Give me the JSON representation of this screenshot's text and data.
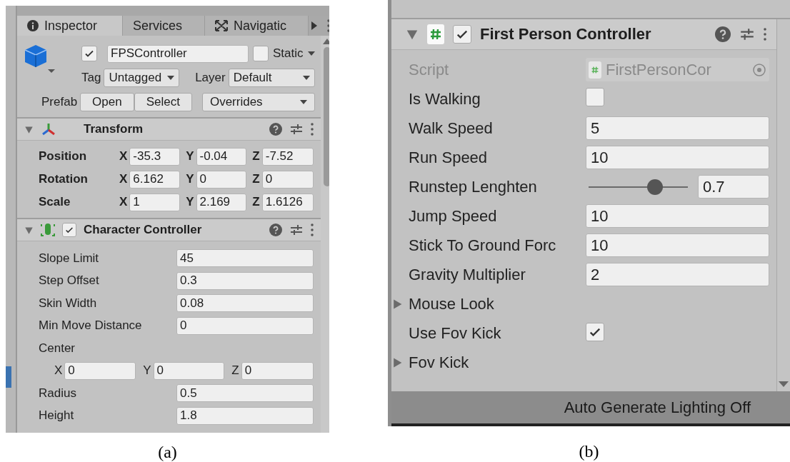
{
  "panel_a": {
    "tabs": [
      {
        "label": "Inspector",
        "selected": true
      },
      {
        "label": "Services",
        "selected": false
      },
      {
        "label": "Navigatic",
        "selected": false
      }
    ],
    "object": {
      "active": true,
      "name": "FPSController",
      "static": false,
      "static_label": "Static",
      "tag_label": "Tag",
      "tag": "Untagged",
      "layer_label": "Layer",
      "layer": "Default",
      "prefab_label": "Prefab",
      "prefab_buttons": [
        "Open",
        "Select"
      ],
      "overrides": "Overrides"
    },
    "transform": {
      "title": "Transform",
      "expanded": true,
      "rows": [
        {
          "label": "Position",
          "axes": [
            {
              "axis": "X",
              "value": "-35.3"
            },
            {
              "axis": "Y",
              "value": "-0.04"
            },
            {
              "axis": "Z",
              "value": "-7.52"
            }
          ]
        },
        {
          "label": "Rotation",
          "axes": [
            {
              "axis": "X",
              "value": "6.162"
            },
            {
              "axis": "Y",
              "value": "0"
            },
            {
              "axis": "Z",
              "value": "0"
            }
          ]
        },
        {
          "label": "Scale",
          "axes": [
            {
              "axis": "X",
              "value": "1"
            },
            {
              "axis": "Y",
              "value": "2.169"
            },
            {
              "axis": "Z",
              "value": "1.6126"
            }
          ]
        }
      ]
    },
    "character_controller": {
      "title": "Character Controller",
      "expanded": true,
      "enabled": true,
      "rows": [
        {
          "kind": "field",
          "label": "Slope Limit",
          "value": "45"
        },
        {
          "kind": "field",
          "label": "Step Offset",
          "value": "0.3"
        },
        {
          "kind": "field",
          "label": "Skin Width",
          "value": "0.08"
        },
        {
          "kind": "field",
          "label": "Min Move Distance",
          "value": "0"
        },
        {
          "kind": "heading",
          "label": "Center"
        },
        {
          "kind": "vector",
          "axes": [
            {
              "axis": "X",
              "value": "0"
            },
            {
              "axis": "Y",
              "value": "0"
            },
            {
              "axis": "Z",
              "value": "0"
            }
          ]
        },
        {
          "kind": "field",
          "label": "Radius",
          "value": "0.5"
        },
        {
          "kind": "field",
          "label": "Height",
          "value": "1.8"
        }
      ]
    },
    "caption": "(a)"
  },
  "panel_b": {
    "component": {
      "title": "First Person Controller",
      "expanded": true,
      "enabled": true
    },
    "rows": [
      {
        "kind": "script",
        "label": "Script",
        "value": "FirstPersonCor",
        "disabled": true
      },
      {
        "kind": "checkbox",
        "label": "Is Walking",
        "checked": false
      },
      {
        "kind": "field",
        "label": "Walk Speed",
        "value": "5"
      },
      {
        "kind": "field",
        "label": "Run Speed",
        "value": "10"
      },
      {
        "kind": "slider",
        "label": "Runstep Lenghten",
        "level": 0.7,
        "value": "0.7"
      },
      {
        "kind": "field",
        "label": "Jump Speed",
        "value": "10"
      },
      {
        "kind": "field",
        "label": "Stick To Ground Forc",
        "value": "10"
      },
      {
        "kind": "field",
        "label": "Gravity Multiplier",
        "value": "2"
      },
      {
        "kind": "foldout",
        "label": "Mouse Look",
        "expanded": false
      },
      {
        "kind": "checkbox",
        "label": "Use Fov Kick",
        "checked": true
      },
      {
        "kind": "foldout",
        "label": "Fov Kick",
        "expanded": false
      }
    ],
    "status_bar": "Auto Generate Lighting Off",
    "caption": "(b)"
  }
}
